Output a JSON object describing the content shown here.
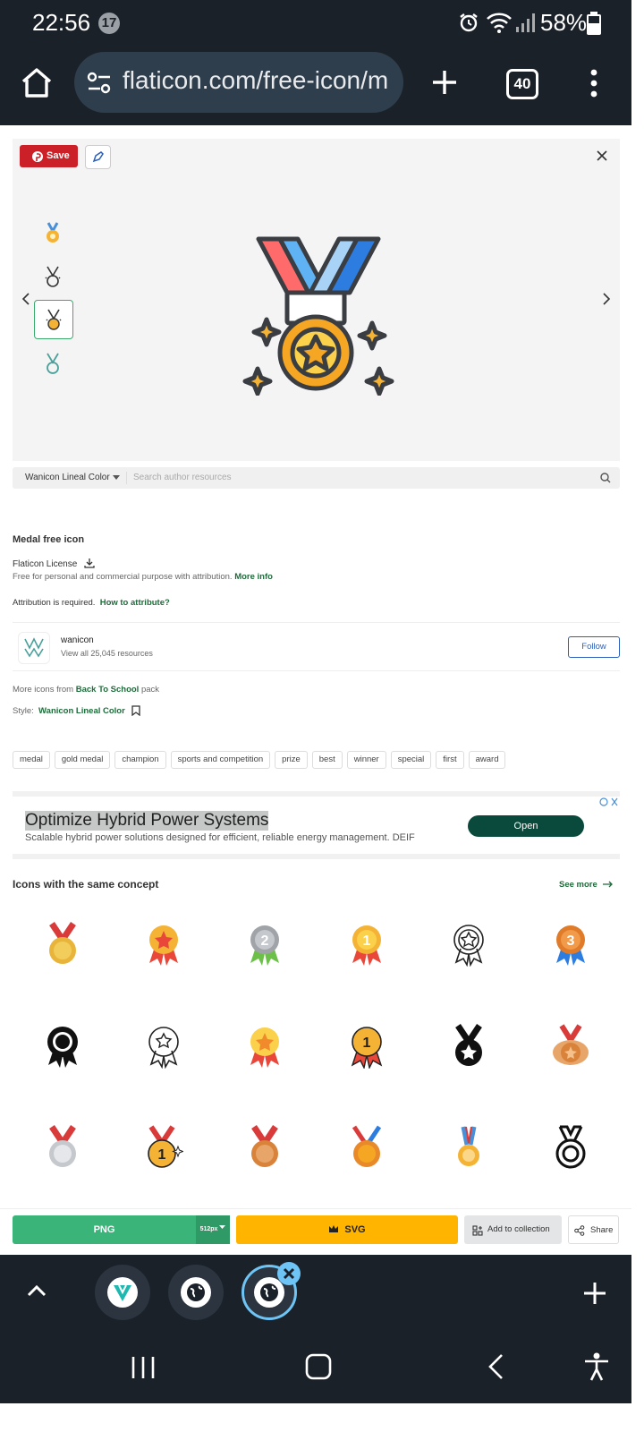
{
  "status_bar": {
    "time": "22:56",
    "notification_count": "17",
    "battery": "58%"
  },
  "browser": {
    "url": "flaticon.com/free-icon/m",
    "tab_count": "40"
  },
  "preview": {
    "save_label": "Save",
    "thumbnail_count": 4,
    "selected_thumbnail": 3
  },
  "author_bar": {
    "selected": "Wanicon Lineal Color",
    "search_placeholder": "Search author resources"
  },
  "details": {
    "title": "Medal free icon",
    "license_title": "Flaticon License",
    "license_desc": "Free for personal and commercial purpose with attribution.",
    "more_info": "More info",
    "attribution_text": "Attribution is required.",
    "how_to_attribute": "How to attribute?",
    "author_name": "wanicon",
    "author_resources": "View all 25,045 resources",
    "follow": "Follow",
    "pack_prefix": "More icons from",
    "pack_name": "Back To School",
    "pack_suffix": "pack",
    "style_prefix": "Style:",
    "style_name": "Wanicon Lineal Color"
  },
  "tags": [
    "medal",
    "gold medal",
    "champion",
    "sports and competition",
    "prize",
    "best",
    "winner",
    "special",
    "first",
    "award"
  ],
  "ad": {
    "title": "Optimize Hybrid Power Systems",
    "description": "Scalable hybrid power solutions designed for efficient, reliable energy management. DEIF",
    "cta": "Open"
  },
  "related": {
    "title": "Icons with the same concept",
    "see_more": "See more",
    "icons": [
      "red-ribbon-gold-medal",
      "gold-star-rosette",
      "silver-2-rosette",
      "gold-1-rosette",
      "outline-star-rosette",
      "bronze-3-rosette",
      "black-rosette",
      "outline-star-rosette-2",
      "gold-star-rosette-2",
      "gold-1-rosette-outline",
      "black-star-medal",
      "3d-bronze-medal",
      "silver-medal",
      "gold-1-medal-outline",
      "bronze-medal",
      "gold-medal-tricolor",
      "gold-medal-blue-ribbon",
      "outline-medal"
    ]
  },
  "actions": {
    "png": "PNG",
    "png_size": "512px",
    "svg": "SVG",
    "add_collection": "Add to collection",
    "share": "Share"
  },
  "colors": {
    "accent_green": "#3bb47a",
    "svg_yellow": "#ffb400",
    "chrome_dark": "#1b2129",
    "link_green": "#1d6c3a"
  }
}
